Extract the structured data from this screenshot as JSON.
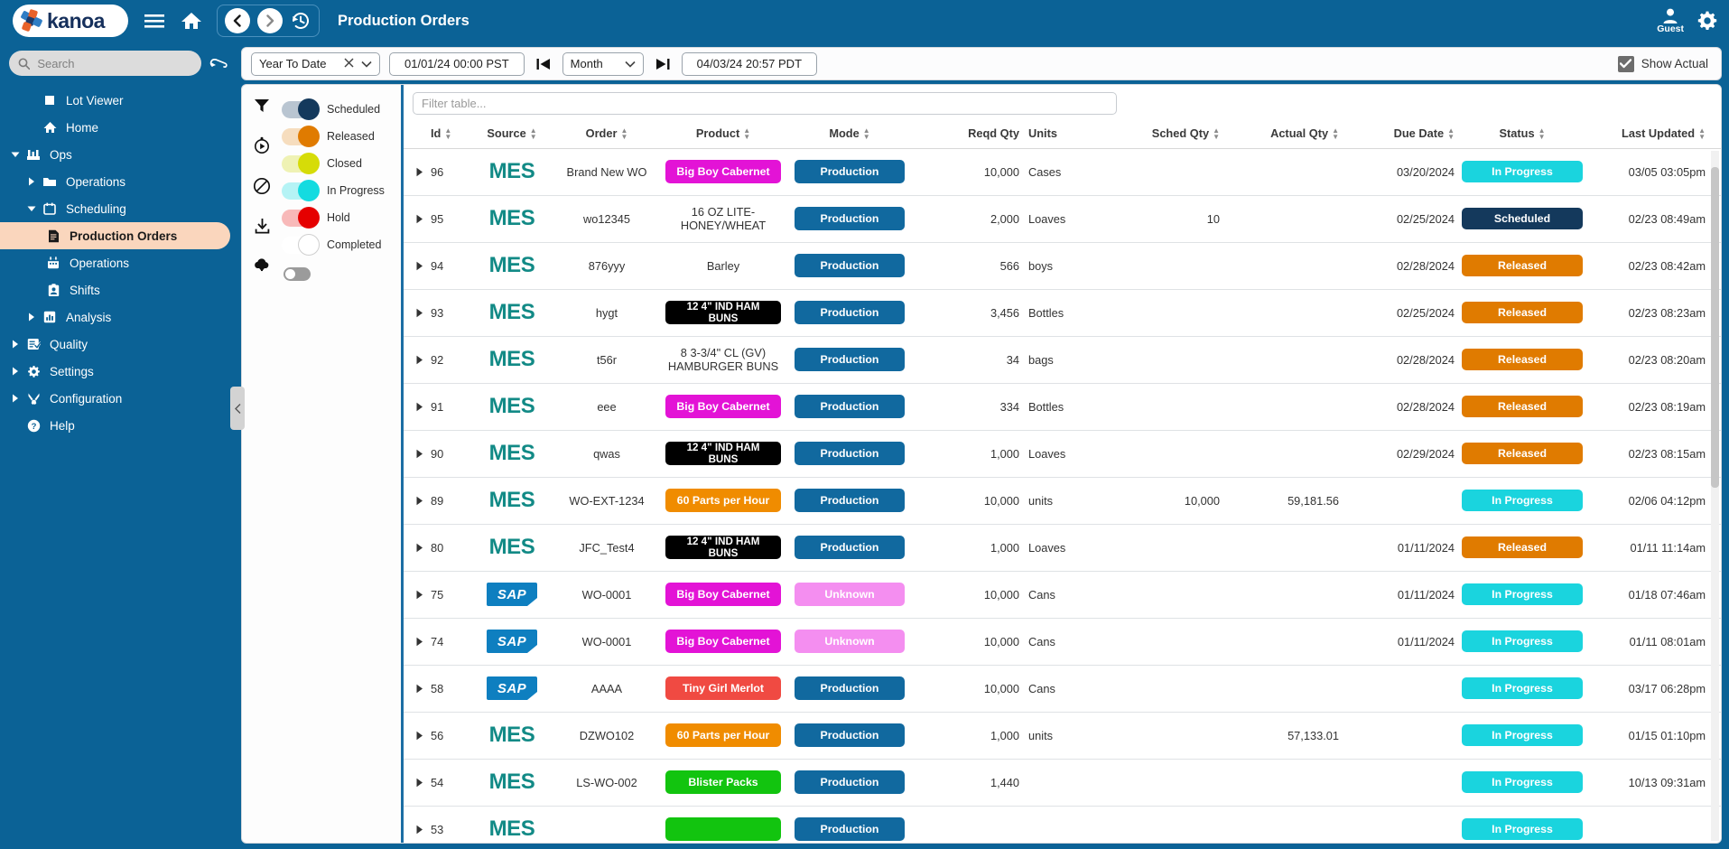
{
  "topbar": {
    "brand": "kanoa",
    "page_title": "Production Orders",
    "user_name": "Guest",
    "icons": {
      "menu": "hamburger-menu-icon",
      "home": "home-icon",
      "back": "back-chevron-icon",
      "forward": "forward-chevron-icon",
      "history": "history-clock-icon",
      "user": "user-avatar-icon",
      "settings": "gear-icon"
    }
  },
  "sidebar": {
    "search_placeholder": "Search",
    "items": [
      {
        "label": "Lot Viewer",
        "level": 1,
        "icon": "square-icon",
        "caret": "none",
        "active": false
      },
      {
        "label": "Home",
        "level": 1,
        "icon": "home-icon",
        "caret": "none",
        "active": false
      },
      {
        "label": "Ops",
        "level": 0,
        "icon": "factory-icon",
        "caret": "down",
        "active": false
      },
      {
        "label": "Operations",
        "level": 1,
        "icon": "folder-icon",
        "caret": "right",
        "active": false
      },
      {
        "label": "Scheduling",
        "level": 1,
        "icon": "calendar-icon",
        "caret": "down",
        "active": false
      },
      {
        "label": "Production Orders",
        "level": 2,
        "icon": "document-icon",
        "caret": "none",
        "active": true
      },
      {
        "label": "Operations",
        "level": 2,
        "icon": "calendar-alt-icon",
        "caret": "none",
        "active": false
      },
      {
        "label": "Shifts",
        "level": 2,
        "icon": "badge-icon",
        "caret": "none",
        "active": false
      },
      {
        "label": "Analysis",
        "level": 1,
        "icon": "bar-chart-icon",
        "caret": "right",
        "active": false
      },
      {
        "label": "Quality",
        "level": 0,
        "icon": "checklist-icon",
        "caret": "right",
        "active": false
      },
      {
        "label": "Settings",
        "level": 0,
        "icon": "gear-icon",
        "caret": "right",
        "active": false
      },
      {
        "label": "Configuration",
        "level": 0,
        "icon": "tools-icon",
        "caret": "right",
        "active": false
      },
      {
        "label": "Help",
        "level": 0,
        "icon": "help-circle-icon",
        "caret": "none",
        "active": false
      }
    ]
  },
  "controlbar": {
    "range_preset": "Year To Date",
    "start_date": "01/01/24 00:00 PST",
    "interval": "Month",
    "end_date": "04/03/24 20:57 PDT",
    "show_actual_label": "Show Actual",
    "show_actual_checked": true
  },
  "rail": {
    "icons": [
      {
        "name": "filter-icon"
      },
      {
        "name": "history-replay-icon"
      },
      {
        "name": "block-icon"
      },
      {
        "name": "download-icon"
      },
      {
        "name": "cloud-download-icon"
      }
    ],
    "legend": [
      {
        "label": "Scheduled",
        "color": "#14395c",
        "track": "#b9c5d1",
        "on": true
      },
      {
        "label": "Released",
        "color": "#e07b00",
        "track": "#f6ddbe",
        "on": true
      },
      {
        "label": "Closed",
        "color": "#d6dc08",
        "track": "#eff2b4",
        "on": true
      },
      {
        "label": "In Progress",
        "color": "#14dbe0",
        "track": "#b5f3f5",
        "on": true
      },
      {
        "label": "Hold",
        "color": "#e50000",
        "track": "#f8b9b9",
        "on": true
      },
      {
        "label": "Completed",
        "color": "#ffffff",
        "track": "#ffffff",
        "on": false
      }
    ]
  },
  "table": {
    "filter_placeholder": "Filter table...",
    "columns": [
      {
        "key": "id",
        "label": "Id",
        "sortable": true
      },
      {
        "key": "source",
        "label": "Source",
        "sortable": true
      },
      {
        "key": "order",
        "label": "Order",
        "sortable": true
      },
      {
        "key": "product",
        "label": "Product",
        "sortable": true
      },
      {
        "key": "mode",
        "label": "Mode",
        "sortable": true
      },
      {
        "key": "reqd",
        "label": "Reqd Qty",
        "sortable": false
      },
      {
        "key": "units",
        "label": "Units",
        "sortable": false
      },
      {
        "key": "sched",
        "label": "Sched Qty",
        "sortable": true
      },
      {
        "key": "actual",
        "label": "Actual Qty",
        "sortable": true
      },
      {
        "key": "due",
        "label": "Due Date",
        "sortable": true
      },
      {
        "key": "status",
        "label": "Status",
        "sortable": true
      },
      {
        "key": "updated",
        "label": "Last Updated",
        "sortable": true
      }
    ],
    "rows": [
      {
        "id": "96",
        "source": "MES",
        "order": "Brand New WO",
        "product": "Big Boy Cabernet",
        "product_chip": true,
        "product_bg": "#e313d6",
        "product_fg": "#ffffff",
        "mode": "Production",
        "mode_bg": "#11699f",
        "reqd": "10,000",
        "units": "Cases",
        "sched": "",
        "actual": "",
        "due": "03/20/2024",
        "status": "In Progress",
        "status_bg": "#1ad4de",
        "status_fg": "#ffffff",
        "updated": "03/05 03:05pm"
      },
      {
        "id": "95",
        "source": "MES",
        "order": "wo12345",
        "product": "16 OZ LITE-HONEY/WHEAT",
        "product_chip": false,
        "product_bg": "",
        "product_fg": "#333333",
        "mode": "Production",
        "mode_bg": "#11699f",
        "reqd": "2,000",
        "units": "Loaves",
        "sched": "10",
        "actual": "",
        "due": "02/25/2024",
        "status": "Scheduled",
        "status_bg": "#14395c",
        "status_fg": "#ffffff",
        "updated": "02/23 08:49am"
      },
      {
        "id": "94",
        "source": "MES",
        "order": "876yyy",
        "product": "Barley",
        "product_chip": false,
        "product_bg": "",
        "product_fg": "#333333",
        "mode": "Production",
        "mode_bg": "#11699f",
        "reqd": "566",
        "units": "boys",
        "sched": "",
        "actual": "",
        "due": "02/28/2024",
        "status": "Released",
        "status_bg": "#e07b00",
        "status_fg": "#ffffff",
        "updated": "02/23 08:42am"
      },
      {
        "id": "93",
        "source": "MES",
        "order": "hygt",
        "product": "12 4\" IND HAM BUNS",
        "product_chip": true,
        "product_bg": "#000000",
        "product_fg": "#ffffff",
        "mode": "Production",
        "mode_bg": "#11699f",
        "reqd": "3,456",
        "units": "Bottles",
        "sched": "",
        "actual": "",
        "due": "02/25/2024",
        "status": "Released",
        "status_bg": "#e07b00",
        "status_fg": "#ffffff",
        "updated": "02/23 08:23am"
      },
      {
        "id": "92",
        "source": "MES",
        "order": "t56r",
        "product": "8 3-3/4\" CL (GV) HAMBURGER BUNS",
        "product_chip": false,
        "product_bg": "",
        "product_fg": "#333333",
        "mode": "Production",
        "mode_bg": "#11699f",
        "reqd": "34",
        "units": "bags",
        "sched": "",
        "actual": "",
        "due": "02/28/2024",
        "status": "Released",
        "status_bg": "#e07b00",
        "status_fg": "#ffffff",
        "updated": "02/23 08:20am"
      },
      {
        "id": "91",
        "source": "MES",
        "order": "eee",
        "product": "Big Boy Cabernet",
        "product_chip": true,
        "product_bg": "#e313d6",
        "product_fg": "#ffffff",
        "mode": "Production",
        "mode_bg": "#11699f",
        "reqd": "334",
        "units": "Bottles",
        "sched": "",
        "actual": "",
        "due": "02/28/2024",
        "status": "Released",
        "status_bg": "#e07b00",
        "status_fg": "#ffffff",
        "updated": "02/23 08:19am"
      },
      {
        "id": "90",
        "source": "MES",
        "order": "qwas",
        "product": "12 4\" IND HAM BUNS",
        "product_chip": true,
        "product_bg": "#000000",
        "product_fg": "#ffffff",
        "mode": "Production",
        "mode_bg": "#11699f",
        "reqd": "1,000",
        "units": "Loaves",
        "sched": "",
        "actual": "",
        "due": "02/29/2024",
        "status": "Released",
        "status_bg": "#e07b00",
        "status_fg": "#ffffff",
        "updated": "02/23 08:15am"
      },
      {
        "id": "89",
        "source": "MES",
        "order": "WO-EXT-1234",
        "product": "60 Parts per Hour",
        "product_chip": true,
        "product_bg": "#f08c00",
        "product_fg": "#ffffff",
        "mode": "Production",
        "mode_bg": "#11699f",
        "reqd": "10,000",
        "units": "units",
        "sched": "10,000",
        "actual": "59,181.56",
        "due": "",
        "status": "In Progress",
        "status_bg": "#1ad4de",
        "status_fg": "#ffffff",
        "updated": "02/06 04:12pm"
      },
      {
        "id": "80",
        "source": "MES",
        "order": "JFC_Test4",
        "product": "12 4\" IND HAM BUNS",
        "product_chip": true,
        "product_bg": "#000000",
        "product_fg": "#ffffff",
        "mode": "Production",
        "mode_bg": "#11699f",
        "reqd": "1,000",
        "units": "Loaves",
        "sched": "",
        "actual": "",
        "due": "01/11/2024",
        "status": "Released",
        "status_bg": "#e07b00",
        "status_fg": "#ffffff",
        "updated": "01/11 11:14am"
      },
      {
        "id": "75",
        "source": "SAP",
        "order": "WO-0001",
        "product": "Big Boy Cabernet",
        "product_chip": true,
        "product_bg": "#e313d6",
        "product_fg": "#ffffff",
        "mode": "Unknown",
        "mode_bg": "#f48ef0",
        "reqd": "10,000",
        "units": "Cans",
        "sched": "",
        "actual": "",
        "due": "01/11/2024",
        "status": "In Progress",
        "status_bg": "#1ad4de",
        "status_fg": "#ffffff",
        "updated": "01/18 07:46am"
      },
      {
        "id": "74",
        "source": "SAP",
        "order": "WO-0001",
        "product": "Big Boy Cabernet",
        "product_chip": true,
        "product_bg": "#e313d6",
        "product_fg": "#ffffff",
        "mode": "Unknown",
        "mode_bg": "#f48ef0",
        "reqd": "10,000",
        "units": "Cans",
        "sched": "",
        "actual": "",
        "due": "01/11/2024",
        "status": "In Progress",
        "status_bg": "#1ad4de",
        "status_fg": "#ffffff",
        "updated": "01/11 08:01am"
      },
      {
        "id": "58",
        "source": "SAP",
        "order": "AAAA",
        "product": "Tiny Girl Merlot",
        "product_chip": true,
        "product_bg": "#f04a42",
        "product_fg": "#ffffff",
        "mode": "Production",
        "mode_bg": "#11699f",
        "reqd": "10,000",
        "units": "Cans",
        "sched": "",
        "actual": "",
        "due": "",
        "status": "In Progress",
        "status_bg": "#1ad4de",
        "status_fg": "#ffffff",
        "updated": "03/17 06:28pm"
      },
      {
        "id": "56",
        "source": "MES",
        "order": "DZWO102",
        "product": "60 Parts per Hour",
        "product_chip": true,
        "product_bg": "#f08c00",
        "product_fg": "#ffffff",
        "mode": "Production",
        "mode_bg": "#11699f",
        "reqd": "1,000",
        "units": "units",
        "sched": "",
        "actual": "57,133.01",
        "due": "",
        "status": "In Progress",
        "status_bg": "#1ad4de",
        "status_fg": "#ffffff",
        "updated": "01/15 01:10pm"
      },
      {
        "id": "54",
        "source": "MES",
        "order": "LS-WO-002",
        "product": "Blister Packs",
        "product_chip": true,
        "product_bg": "#12c40f",
        "product_fg": "#ffffff",
        "mode": "Production",
        "mode_bg": "#11699f",
        "reqd": "1,440",
        "units": "",
        "sched": "",
        "actual": "",
        "due": "",
        "status": "In Progress",
        "status_bg": "#1ad4de",
        "status_fg": "#ffffff",
        "updated": "10/13 09:31am"
      },
      {
        "id": "53",
        "source": "MES",
        "order": "",
        "product": "",
        "product_chip": true,
        "product_bg": "#12c40f",
        "product_fg": "#ffffff",
        "mode": "Production",
        "mode_bg": "#11699f",
        "reqd": "",
        "units": "",
        "sched": "",
        "actual": "",
        "due": "",
        "status": "In Progress",
        "status_bg": "#1ad4de",
        "status_fg": "#ffffff",
        "updated": ""
      }
    ]
  }
}
